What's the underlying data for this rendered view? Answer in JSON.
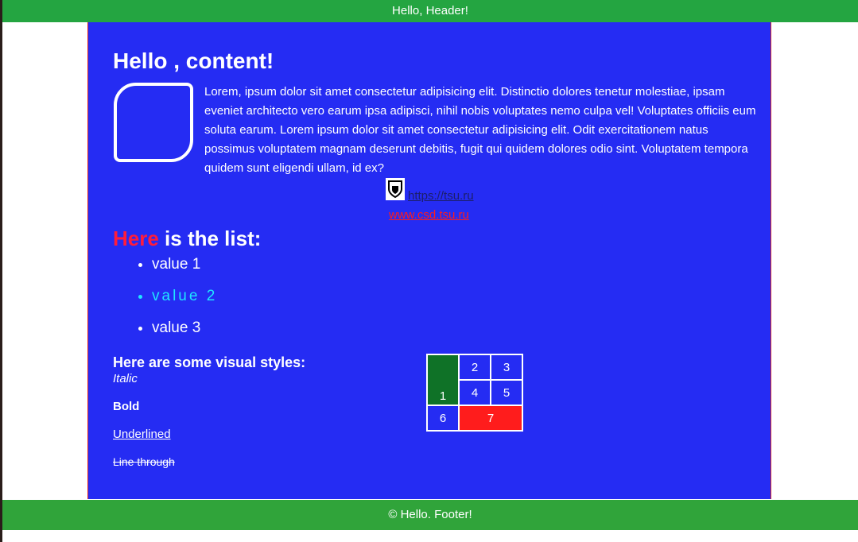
{
  "header": {
    "text": "Hello, Header!"
  },
  "content": {
    "title": "Hello , content!",
    "paragraph": "Lorem, ipsum dolor sit amet consectetur adipisicing elit. Distinctio dolores tenetur molestiae, ipsam eveniet architecto vero earum ipsa adipisci, nihil nobis voluptates nemo culpa vel! Voluptates officiis eum soluta earum. Lorem ipsum dolor sit amet consectetur adipisicing elit. Odit exercitationem natus possimus voluptatem magnam deserunt debitis, fugit qui quidem dolores odio sint. Voluptatem tempora quidem sunt eligendi ullam, id ex?",
    "link1": "https://tsu.ru",
    "link2": "www.csd.tsu.ru",
    "list_heading_red": "Here",
    "list_heading_rest": " is the list:",
    "list_items": [
      "value 1",
      "value 2",
      "value 3"
    ],
    "styles_title": "Here are some visual styles:",
    "style_italic": "Italic",
    "style_bold": "Bold",
    "style_underlined": "Underlined",
    "style_line_through": "Line through",
    "table": {
      "c1": "1",
      "c2": "2",
      "c3": "3",
      "c4": "4",
      "c5": "5",
      "c6": "6",
      "c7": "7"
    }
  },
  "footer": {
    "text": "© Hello. Footer!"
  },
  "colors": {
    "header_bg": "#24a541",
    "main_bg": "#252cf3",
    "footer_bg": "#30a43a",
    "accent_red": "#ff1c3c",
    "accent_cyan": "#1fe6ff",
    "cell_green": "#0f7227",
    "cell_red": "#ff1c1c"
  },
  "icons": {
    "logo": "university-crest-icon"
  }
}
